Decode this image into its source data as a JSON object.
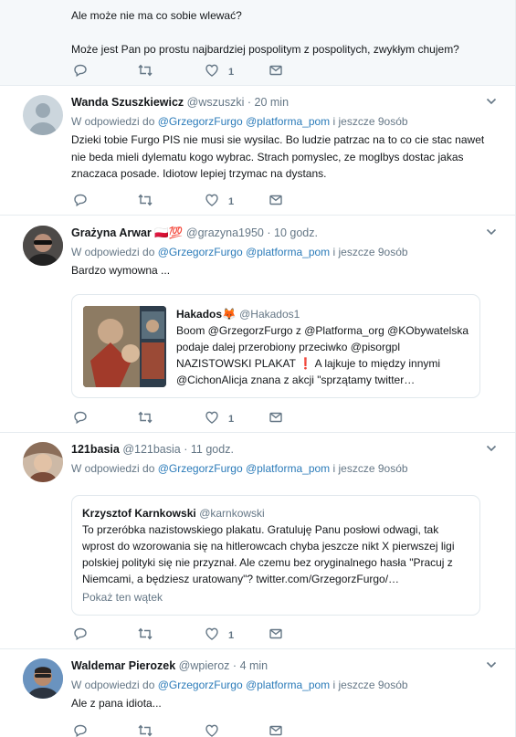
{
  "tweets": [
    {
      "text_lines": [
        "Ale może nie ma co sobie wlewać?",
        "",
        "Może jest Pan po prostu najbardziej pospolitym z pospolitych, zwykłym chujem?"
      ],
      "like_count": "1"
    },
    {
      "name": "Wanda Szuszkiewicz",
      "handle": "@wszuszki",
      "time": "20 min",
      "reply_prefix": "W odpowiedzi do",
      "reply_to": "@GrzegorzFurgo @platforma_pom",
      "reply_more": "i jeszcze 9osób",
      "text": "Dzieki tobie Furgo PIS nie musi sie wysilac. Bo ludzie patrzac na to co cie stac nawet nie beda mieli dylematu kogo wybrac.  Strach pomyslec, ze moglbys dostac jakas znaczaca posade. Idiotow lepiej trzymac na dystans.",
      "like_count": "1"
    },
    {
      "name": "Grażyna Arwar",
      "emoji": "🇵🇱💯",
      "handle": "@grazyna1950",
      "time": "10 godz.",
      "reply_prefix": "W odpowiedzi do",
      "reply_to": "@GrzegorzFurgo @platforma_pom",
      "reply_more": "i jeszcze 9osób",
      "text": "Bardzo wymowna ...",
      "like_count": "1",
      "quote": {
        "name": "Hakados",
        "emoji": "🦊",
        "handle": "@Hakados1",
        "text": "Boom @GrzegorzFurgo z @Platforma_org @KObywatelska podaje dalej przerobiony przeciwko @pisorgpl NAZISTOWSKI PLAKAT ❗ A lajkuje to między innymi @CichonAlicja znana z akcji \"sprzątamy twitter…"
      }
    },
    {
      "name": "121basia",
      "handle": "@121basia",
      "time": "11 godz.",
      "reply_prefix": "W odpowiedzi do",
      "reply_to": "@GrzegorzFurgo @platforma_pom",
      "reply_more": "i jeszcze 9osób",
      "like_count": "1",
      "quote": {
        "name": "Krzysztof Karnkowski",
        "handle": "@karnkowski",
        "text": "To przeróbka nazistowskiego plakatu. Gratuluję Panu posłowi odwagi, tak wprost do wzorowania się na hitlerowcach chyba jeszcze nikt X pierwszej ligi polskiej polityki się nie przyznał. Ale czemu bez oryginalnego hasła \"Pracuj z Niemcami, a będziesz uratowany\"? twitter.com/GrzegorzFurgo/…",
        "show_thread": "Pokaż ten wątek"
      }
    },
    {
      "name": "Waldemar Pierozek",
      "handle": "@wpieroz",
      "time": "4 min",
      "reply_prefix": "W odpowiedzi do",
      "reply_to": "@GrzegorzFurgo @platforma_pom",
      "reply_more": "i jeszcze 9osób",
      "text": "Ale z pana idiota..."
    }
  ],
  "icons": {
    "reply": "reply-icon",
    "retweet": "retweet-icon",
    "like": "heart-icon",
    "dm": "envelope-icon",
    "more": "chevron-down-icon"
  },
  "colors": {
    "link": "#2b7bb9",
    "muted": "#657786",
    "highlight_bg": "#f5f8fa"
  }
}
